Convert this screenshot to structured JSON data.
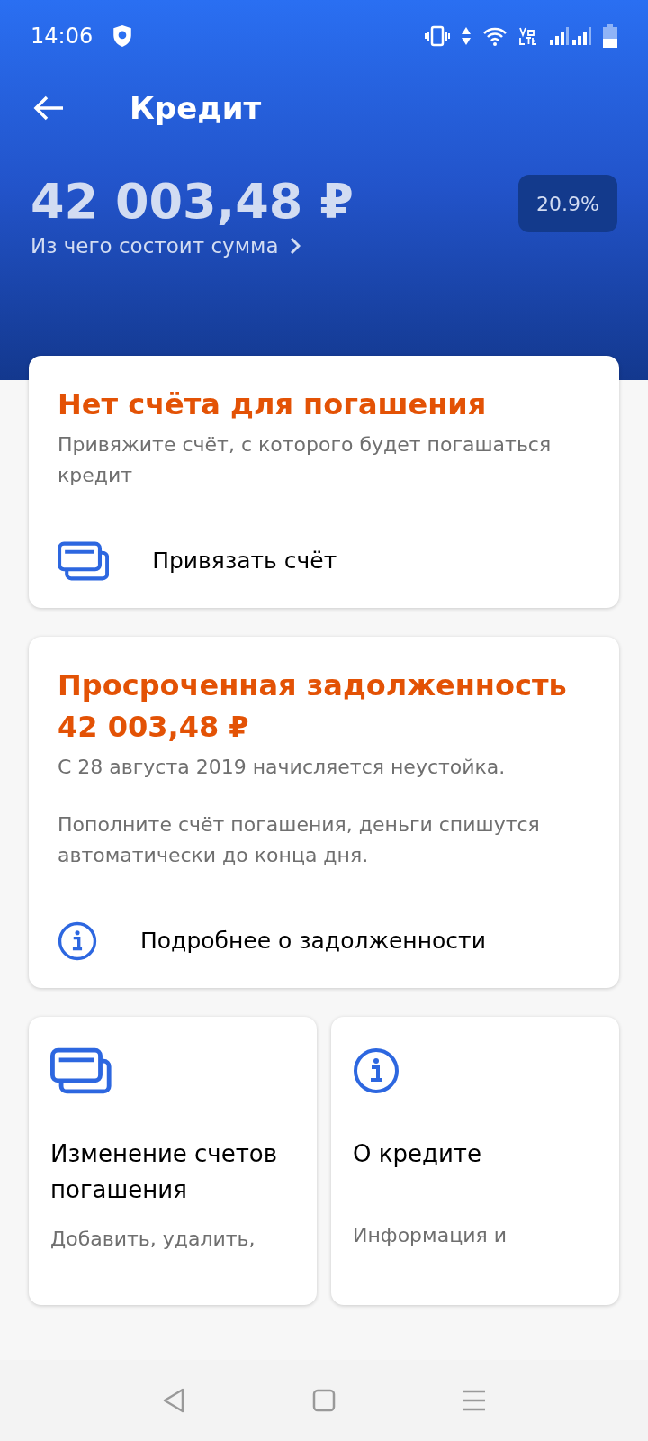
{
  "status_bar": {
    "time": "14:06"
  },
  "header": {
    "title": "Кредит",
    "amount": "42 003,48 ₽",
    "breakdown_link": "Из чего состоит сумма",
    "rate_badge": "20.9%"
  },
  "cards": [
    {
      "title": "Нет счёта для погашения",
      "description": "Привяжите счёт, с которого будет погашаться кредит",
      "action": {
        "kind": "cards",
        "label": "Привязать счёт"
      }
    },
    {
      "title": "Просроченная задолженность",
      "amount": "42 003,48 ₽",
      "paragraphs": [
        "С 28 августа 2019 начисляется неустойка.",
        "Пополните счёт погашения, деньги спишутся автоматически до конца дня."
      ],
      "action": {
        "kind": "info",
        "label": "Подробнее о задолженности"
      }
    }
  ],
  "tiles": [
    {
      "kind": "cards",
      "title": "Изменение счетов погашения",
      "description": "Добавить, удалить,"
    },
    {
      "kind": "info",
      "title": "О кредите",
      "description": "Информация и"
    }
  ]
}
